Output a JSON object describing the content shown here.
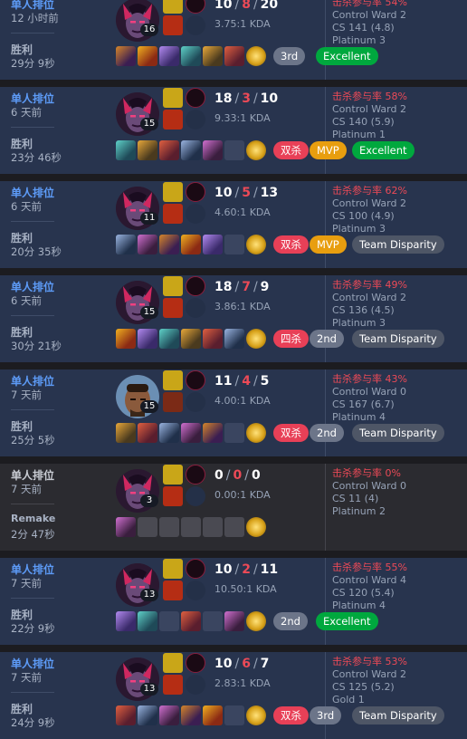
{
  "matches": [
    {
      "queue": "单人排位",
      "time_ago": "12 小时前",
      "result": "胜利",
      "duration": "29分 9秒",
      "champion_icon": "evelynn-portrait",
      "level": "16",
      "spells": [
        "flash-spell",
        "ignite-spell"
      ],
      "runes": [
        "electrocute-rune",
        "sorcery-rune"
      ],
      "kills": "10",
      "deaths": "8",
      "assists": "20",
      "kda_ratio": "3.75:1 KDA",
      "kill_participation": "击杀参与率 54%",
      "control_ward": "Control Ward 2",
      "cs": "CS 141 (4.8)",
      "rank": "Platinum 3",
      "items": [
        "item-1",
        "item-2",
        "item-3",
        "item-4",
        "item-5",
        "item-6"
      ],
      "trinket": "oracle-lens",
      "badges": [
        {
          "label": "3rd",
          "color": "#6c7589"
        },
        {
          "label": "Excellent",
          "color": "#00a83e"
        }
      ]
    },
    {
      "queue": "单人排位",
      "time_ago": "6 天前",
      "result": "胜利",
      "duration": "23分 46秒",
      "champion_icon": "evelynn-portrait",
      "level": "15",
      "spells": [
        "flash-spell",
        "ignite-spell"
      ],
      "runes": [
        "electrocute-rune",
        "sorcery-rune"
      ],
      "kills": "18",
      "deaths": "3",
      "assists": "10",
      "kda_ratio": "9.33:1 KDA",
      "kill_participation": "击杀参与率 58%",
      "control_ward": "Control Ward 2",
      "cs": "CS 140 (5.9)",
      "rank": "Platinum 1",
      "items": [
        "item-1",
        "item-2",
        "item-3",
        "item-4",
        "item-5",
        "empty"
      ],
      "trinket": "oracle-lens",
      "badges": [
        {
          "label": "双杀",
          "color": "#e84057"
        },
        {
          "label": "MVP",
          "color": "#e89e0f"
        },
        {
          "label": "Excellent",
          "color": "#00a83e"
        }
      ]
    },
    {
      "queue": "单人排位",
      "time_ago": "6 天前",
      "result": "胜利",
      "duration": "20分 35秒",
      "champion_icon": "evelynn-portrait",
      "level": "11",
      "spells": [
        "flash-spell",
        "ignite-spell"
      ],
      "runes": [
        "electrocute-rune",
        "sorcery-rune"
      ],
      "kills": "10",
      "deaths": "5",
      "assists": "13",
      "kda_ratio": "4.60:1 KDA",
      "kill_participation": "击杀参与率 62%",
      "control_ward": "Control Ward 2",
      "cs": "CS 100 (4.9)",
      "rank": "Platinum 3",
      "items": [
        "item-1",
        "item-2",
        "item-3",
        "item-4",
        "item-5",
        "empty"
      ],
      "trinket": "oracle-lens",
      "badges": [
        {
          "label": "双杀",
          "color": "#e84057"
        },
        {
          "label": "MVP",
          "color": "#e89e0f"
        },
        {
          "label": "Team Disparity",
          "color": "#4e5666"
        }
      ]
    },
    {
      "queue": "单人排位",
      "time_ago": "6 天前",
      "result": "胜利",
      "duration": "30分 21秒",
      "champion_icon": "evelynn-portrait",
      "level": "15",
      "spells": [
        "flash-spell",
        "ignite-spell"
      ],
      "runes": [
        "electrocute-rune",
        "sorcery-rune"
      ],
      "kills": "18",
      "deaths": "7",
      "assists": "9",
      "kda_ratio": "3.86:1 KDA",
      "kill_participation": "击杀参与率 49%",
      "control_ward": "Control Ward 2",
      "cs": "CS 136 (4.5)",
      "rank": "Platinum 3",
      "items": [
        "item-1",
        "item-2",
        "item-3",
        "item-4",
        "item-5",
        "item-6"
      ],
      "trinket": "oracle-lens",
      "badges": [
        {
          "label": "四杀",
          "color": "#e84057"
        },
        {
          "label": "2nd",
          "color": "#6c7589"
        },
        {
          "label": "Team Disparity",
          "color": "#4e5666"
        }
      ]
    },
    {
      "queue": "单人排位",
      "time_ago": "7 天前",
      "result": "胜利",
      "duration": "25分 5秒",
      "champion_icon": "graves-portrait",
      "level": "15",
      "spells": [
        "flash-spell",
        "smite-spell"
      ],
      "runes": [
        "fleet-footwork-rune",
        "inspiration-rune"
      ],
      "kills": "11",
      "deaths": "4",
      "assists": "5",
      "kda_ratio": "4.00:1 KDA",
      "kill_participation": "击杀参与率 43%",
      "control_ward": "Control Ward 0",
      "cs": "CS 167 (6.7)",
      "rank": "Platinum 4",
      "items": [
        "item-1",
        "item-2",
        "item-3",
        "item-4",
        "item-5",
        "empty"
      ],
      "trinket": "stealth-ward",
      "badges": [
        {
          "label": "双杀",
          "color": "#e84057"
        },
        {
          "label": "2nd",
          "color": "#6c7589"
        },
        {
          "label": "Team Disparity",
          "color": "#4e5666"
        }
      ]
    },
    {
      "queue": "单人排位",
      "time_ago": "7 天前",
      "result": "Remake",
      "duration": "2分 47秒",
      "champion_icon": "evelynn-portrait",
      "level": "3",
      "spells": [
        "flash-spell",
        "ignite-spell"
      ],
      "runes": [
        "electrocute-rune",
        "sorcery-rune"
      ],
      "kills": "0",
      "deaths": "0",
      "assists": "0",
      "kda_ratio": "0.00:1 KDA",
      "kill_participation": "击杀参与率 0%",
      "control_ward": "Control Ward 0",
      "cs": "CS 11 (4)",
      "rank": "Platinum 2",
      "items": [
        "item-1",
        "empty",
        "empty",
        "empty",
        "empty",
        "empty"
      ],
      "trinket": "stealth-ward",
      "badges": []
    },
    {
      "queue": "单人排位",
      "time_ago": "7 天前",
      "result": "胜利",
      "duration": "22分 9秒",
      "champion_icon": "evelynn-portrait",
      "level": "13",
      "spells": [
        "flash-spell",
        "ignite-spell"
      ],
      "runes": [
        "electrocute-rune",
        "sorcery-rune"
      ],
      "kills": "10",
      "deaths": "2",
      "assists": "11",
      "kda_ratio": "10.50:1 KDA",
      "kill_participation": "击杀参与率 55%",
      "control_ward": "Control Ward 4",
      "cs": "CS 120 (5.4)",
      "rank": "Platinum 4",
      "items": [
        "item-1",
        "item-2",
        "empty",
        "item-4",
        "empty",
        "item-6"
      ],
      "trinket": "oracle-lens",
      "badges": [
        {
          "label": "2nd",
          "color": "#6c7589"
        },
        {
          "label": "Excellent",
          "color": "#00a83e"
        }
      ]
    },
    {
      "queue": "单人排位",
      "time_ago": "7 天前",
      "result": "胜利",
      "duration": "24分 9秒",
      "champion_icon": "evelynn-portrait",
      "level": "13",
      "spells": [
        "flash-spell",
        "ignite-spell"
      ],
      "runes": [
        "electrocute-rune",
        "sorcery-rune"
      ],
      "kills": "10",
      "deaths": "6",
      "assists": "7",
      "kda_ratio": "2.83:1 KDA",
      "kill_participation": "击杀参与率 53%",
      "control_ward": "Control Ward 2",
      "cs": "CS 125 (5.2)",
      "rank": "Gold 1",
      "items": [
        "item-1",
        "item-2",
        "item-3",
        "item-4",
        "item-5",
        "empty"
      ],
      "trinket": "stealth-ward",
      "badges": [
        {
          "label": "双杀",
          "color": "#e84057"
        },
        {
          "label": "3rd",
          "color": "#6c7589"
        },
        {
          "label": "Team Disparity",
          "color": "#4e5666"
        }
      ]
    }
  ]
}
